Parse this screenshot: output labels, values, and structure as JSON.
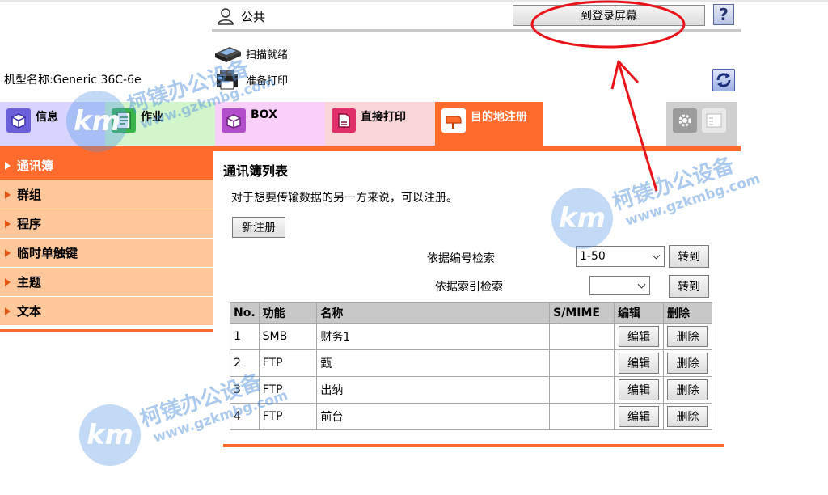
{
  "header": {
    "user_name": "公共",
    "login_button": "到登录屏幕",
    "help_button": "?",
    "scan_status": "扫描就绪",
    "print_status": "准备打印",
    "model_name": "机型名称:Generic 36C-6e"
  },
  "tabs": [
    {
      "label": "信息"
    },
    {
      "label": "作业"
    },
    {
      "label": "BOX"
    },
    {
      "label": "直接打印"
    },
    {
      "label": "目的地注册"
    }
  ],
  "sidebar": {
    "items": [
      {
        "label": "通讯簿"
      },
      {
        "label": "群组"
      },
      {
        "label": "程序"
      },
      {
        "label": "临时单触键"
      },
      {
        "label": "主题"
      },
      {
        "label": "文本"
      }
    ]
  },
  "main": {
    "title": "通讯簿列表",
    "description": "对于想要传输数据的另一方来说，可以注册。",
    "new_button": "新注册",
    "search_by_number_label": "依据编号检索",
    "search_by_number_value": "1-50",
    "search_by_index_label": "依据索引检索",
    "search_by_index_value": "",
    "goto_button": "转到",
    "table": {
      "headers": [
        "No.",
        "功能",
        "名称",
        "S/MIME",
        "编辑",
        "删除"
      ],
      "rows": [
        {
          "no": "1",
          "func": "SMB",
          "name": "财务1",
          "smime": "",
          "edit": "编辑",
          "delete": "删除"
        },
        {
          "no": "2",
          "func": "FTP",
          "name": "甄",
          "smime": "",
          "edit": "编辑",
          "delete": "删除"
        },
        {
          "no": "3",
          "func": "FTP",
          "name": "出纳",
          "smime": "",
          "edit": "编辑",
          "delete": "删除"
        },
        {
          "no": "4",
          "func": "FTP",
          "name": "前台",
          "smime": "",
          "edit": "编辑",
          "delete": "删除"
        }
      ]
    }
  },
  "watermark": {
    "logo": "km",
    "name": "柯镁办公设备",
    "url": "www.gzkmbg.com"
  },
  "colors": {
    "accent": "#ff6b2c",
    "sidebar_bg": "#ffc79a",
    "annotation": "#e8141a"
  },
  "icons": {
    "user": "person-icon",
    "help": "help-icon",
    "refresh": "refresh-icon",
    "scanner": "scanner-icon",
    "printer": "printer-icon"
  }
}
